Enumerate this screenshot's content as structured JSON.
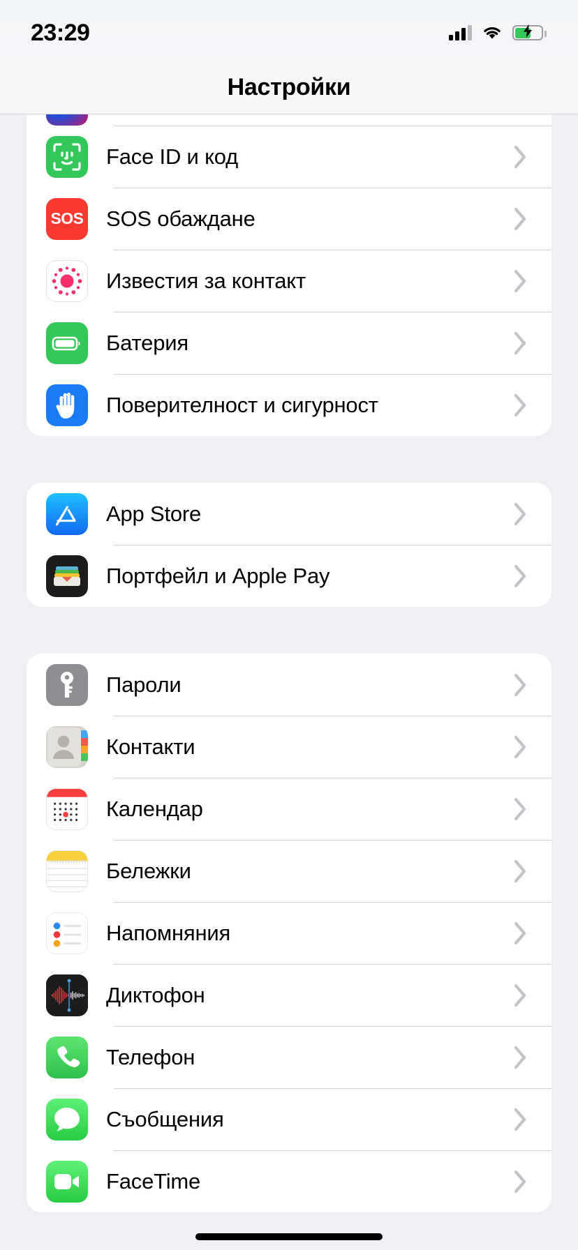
{
  "status_bar": {
    "time": "23:29",
    "signal_icon": "cellular-signal-icon",
    "wifi_icon": "wifi-icon",
    "battery_icon": "battery-charging-icon",
    "battery_charging": true
  },
  "nav": {
    "title": "Настройки"
  },
  "accent": {
    "green": "#34c759",
    "red": "#fa3a32",
    "blue": "#1a7bf5",
    "gray": "#8e8e93",
    "chevron": "#c4c4c8",
    "page_background": "#eff0f4",
    "card_background": "#ffffff",
    "separator": "#d2d2d6"
  },
  "groups": [
    {
      "id": "security-group",
      "clipped_top": true,
      "rows": [
        {
          "id": "siri",
          "label": "",
          "icon": "siri-icon",
          "partial": true
        },
        {
          "id": "face-id",
          "label": "Face ID и код",
          "icon": "face-id-icon"
        },
        {
          "id": "emergency-sos",
          "label": "SOS обаждане",
          "icon": "sos-icon"
        },
        {
          "id": "contact-notifications",
          "label": "Известия за контакт",
          "icon": "contact-notifications-icon"
        },
        {
          "id": "battery",
          "label": "Батерия",
          "icon": "battery-icon"
        },
        {
          "id": "privacy-security",
          "label": "Поверителност и сигурност",
          "icon": "privacy-hand-icon"
        }
      ]
    },
    {
      "id": "store-group",
      "rows": [
        {
          "id": "app-store",
          "label": "App Store",
          "icon": "app-store-icon"
        },
        {
          "id": "wallet-apple-pay",
          "label": "Портфейл и Apple Pay",
          "icon": "wallet-icon"
        }
      ]
    },
    {
      "id": "apps-group",
      "rows": [
        {
          "id": "passwords",
          "label": "Пароли",
          "icon": "key-icon"
        },
        {
          "id": "contacts",
          "label": "Контакти",
          "icon": "contacts-icon"
        },
        {
          "id": "calendar",
          "label": "Календар",
          "icon": "calendar-icon"
        },
        {
          "id": "notes",
          "label": "Бележки",
          "icon": "notes-icon"
        },
        {
          "id": "reminders",
          "label": "Напомняния",
          "icon": "reminders-icon"
        },
        {
          "id": "voice-memos",
          "label": "Диктофон",
          "icon": "voice-memos-icon"
        },
        {
          "id": "phone",
          "label": "Телефон",
          "icon": "phone-icon"
        },
        {
          "id": "messages",
          "label": "Съобщения",
          "icon": "messages-icon"
        },
        {
          "id": "facetime",
          "label": "FaceTime",
          "icon": "facetime-icon"
        }
      ]
    }
  ],
  "home_indicator": "home-indicator"
}
